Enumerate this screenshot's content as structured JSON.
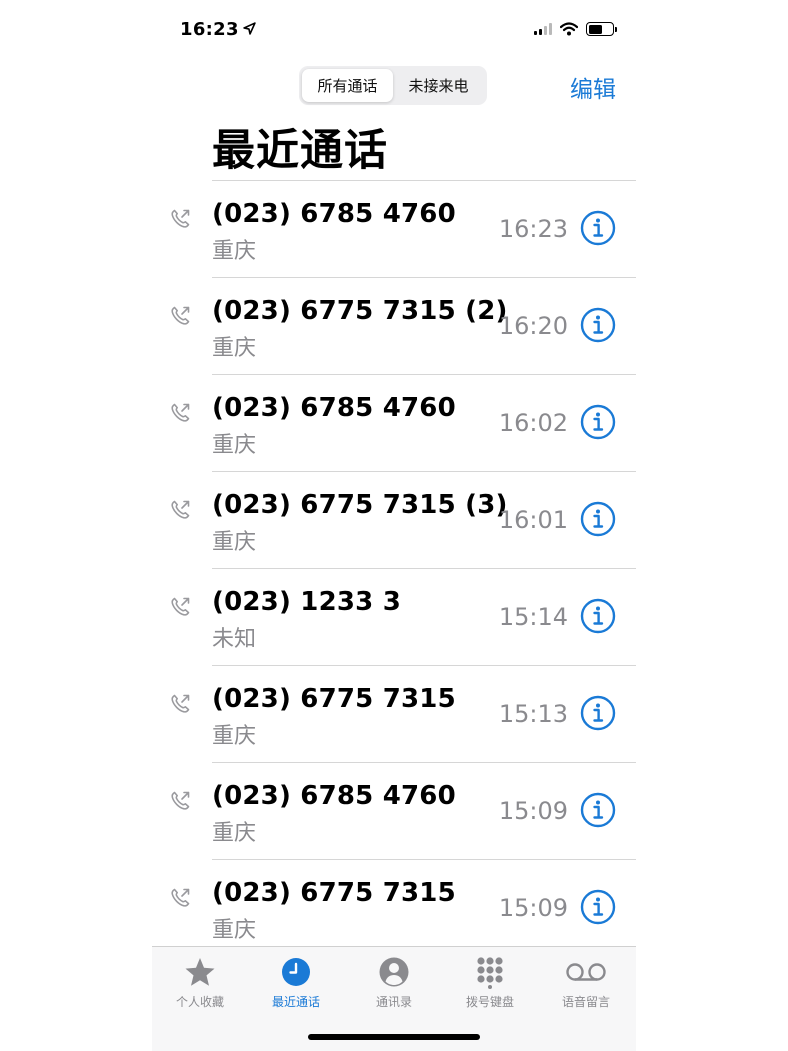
{
  "status": {
    "time": "16:23"
  },
  "header": {
    "segments": [
      "所有通话",
      "未接来电"
    ],
    "edit_label": "编辑",
    "title": "最近通话"
  },
  "calls": [
    {
      "number": "(023) 6785 4760",
      "location": "重庆",
      "time": "16:23"
    },
    {
      "number": "(023) 6775 7315 (2)",
      "location": "重庆",
      "time": "16:20"
    },
    {
      "number": "(023) 6785 4760",
      "location": "重庆",
      "time": "16:02"
    },
    {
      "number": "(023) 6775 7315 (3)",
      "location": "重庆",
      "time": "16:01"
    },
    {
      "number": "(023) 1233 3",
      "location": "未知",
      "time": "15:14"
    },
    {
      "number": "(023) 6775 7315",
      "location": "重庆",
      "time": "15:13"
    },
    {
      "number": "(023) 6785 4760",
      "location": "重庆",
      "time": "15:09"
    },
    {
      "number": "(023) 6775 7315",
      "location": "重庆",
      "time": "15:09"
    }
  ],
  "tabs": [
    {
      "label": "个人收藏",
      "icon": "star-icon"
    },
    {
      "label": "最近通话",
      "icon": "clock-icon",
      "active": true
    },
    {
      "label": "通讯录",
      "icon": "person-icon"
    },
    {
      "label": "拨号键盘",
      "icon": "keypad-icon"
    },
    {
      "label": "语音留言",
      "icon": "voicemail-icon"
    }
  ],
  "colors": {
    "accent": "#1a7ad6",
    "secondary_text": "#8a8a8e",
    "separator": "#d6d6d6"
  }
}
